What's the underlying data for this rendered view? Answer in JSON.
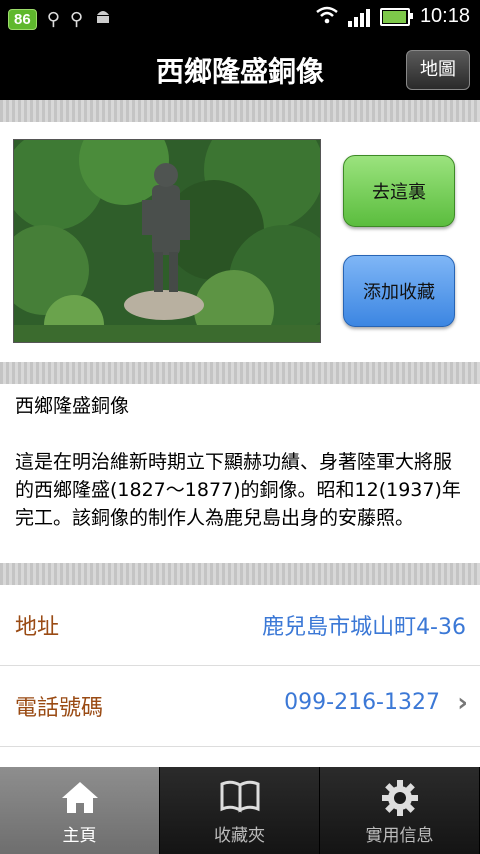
{
  "status": {
    "badge": "86",
    "time": "10:18"
  },
  "header": {
    "title": "西鄉隆盛銅像",
    "map_button": "地圖"
  },
  "actions": {
    "go_here": "去這裏",
    "add_favorite": "添加收藏"
  },
  "description": {
    "title": "西鄉隆盛銅像",
    "body": "這是在明治維新時期立下顯赫功績、身著陸軍大將服的西鄉隆盛(1827～1877)的銅像。昭和12(1937)年完工。該銅像的制作人為鹿兒島出身的安藤照。"
  },
  "info": {
    "address_label": "地址",
    "address_value": "鹿兒島市城山町4-36",
    "phone_label": "電話號碼",
    "phone_value": "099-216-1327"
  },
  "tabs": {
    "home": "主頁",
    "favorites": "收藏夾",
    "info": "實用信息"
  },
  "icons": [
    "home-icon",
    "book-icon",
    "gear-icon",
    "chevron-right-icon",
    "wifi-icon",
    "usb-icon",
    "android-icon"
  ],
  "colors": {
    "label": "#9a4b14",
    "link": "#3b78d6",
    "go_button": "#6cc94c",
    "fav_button": "#4a90e2"
  }
}
